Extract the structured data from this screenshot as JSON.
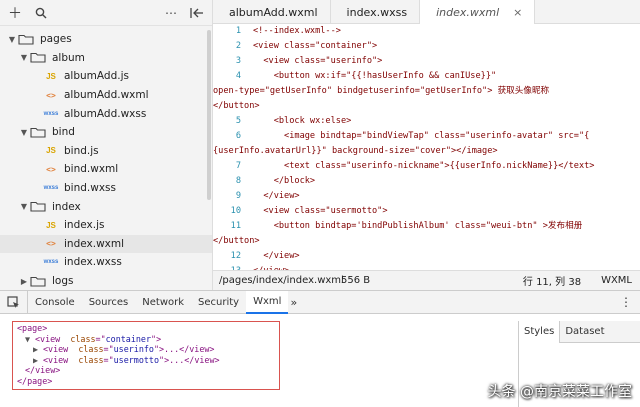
{
  "sidebar": {
    "tree": [
      {
        "label": "pages",
        "type": "folder",
        "depth": 0,
        "expanded": true
      },
      {
        "label": "album",
        "type": "folder",
        "depth": 1,
        "expanded": true
      },
      {
        "label": "albumAdd.js",
        "type": "js",
        "depth": 2
      },
      {
        "label": "albumAdd.wxml",
        "type": "wxml",
        "depth": 2
      },
      {
        "label": "albumAdd.wxss",
        "type": "wxss",
        "depth": 2
      },
      {
        "label": "bind",
        "type": "folder",
        "depth": 1,
        "expanded": true
      },
      {
        "label": "bind.js",
        "type": "js",
        "depth": 2
      },
      {
        "label": "bind.wxml",
        "type": "wxml",
        "depth": 2
      },
      {
        "label": "bind.wxss",
        "type": "wxss",
        "depth": 2
      },
      {
        "label": "index",
        "type": "folder",
        "depth": 1,
        "expanded": true
      },
      {
        "label": "index.js",
        "type": "js",
        "depth": 2
      },
      {
        "label": "index.wxml",
        "type": "wxml",
        "depth": 2,
        "selected": true
      },
      {
        "label": "index.wxss",
        "type": "wxss",
        "depth": 2
      },
      {
        "label": "logs",
        "type": "folder",
        "depth": 1,
        "expanded": false
      }
    ],
    "file_icons": {
      "js": "JS",
      "wxml": "<>",
      "wxss": "wxss"
    }
  },
  "editor": {
    "tabs": [
      {
        "label": "albumAdd.wxml",
        "active": false
      },
      {
        "label": "index.wxss",
        "active": false
      },
      {
        "label": "index.wxml",
        "active": true
      }
    ],
    "close_glyph": "×",
    "code_lines": [
      {
        "ln": "1",
        "text": "<!--index.wxml-->"
      },
      {
        "ln": "2",
        "text": "<view class=\"container\">"
      },
      {
        "ln": "3",
        "text": "  <view class=\"userinfo\">"
      },
      {
        "ln": "4",
        "text": "    <button wx:if=\"{{!hasUserInfo && canIUse}}\""
      },
      {
        "ln": "",
        "text": "open-type=\"getUserInfo\" bindgetuserinfo=\"getUserInfo\"> 获取头像昵称"
      },
      {
        "ln": "",
        "text": "</button>"
      },
      {
        "ln": "5",
        "text": "    <block wx:else>"
      },
      {
        "ln": "6",
        "text": "      <image bindtap=\"bindViewTap\" class=\"userinfo-avatar\" src=\"{"
      },
      {
        "ln": "",
        "text": "{userInfo.avatarUrl}}\" background-size=\"cover\"></image>"
      },
      {
        "ln": "7",
        "text": "      <text class=\"userinfo-nickname\">{{userInfo.nickName}}</text>"
      },
      {
        "ln": "8",
        "text": "    </block>"
      },
      {
        "ln": "9",
        "text": "  </view>"
      },
      {
        "ln": "10",
        "text": "  <view class=\"usermotto\">"
      },
      {
        "ln": "11",
        "text": "    <button bindtap='bindPublishAlbum' class=\"weui-btn\" >发布相册"
      },
      {
        "ln": "",
        "text": "</button>"
      },
      {
        "ln": "12",
        "text": "  </view>"
      },
      {
        "ln": "13",
        "text": "</view>"
      }
    ],
    "status": {
      "path": "/pages/index/index.wxml",
      "size": "556 B",
      "position": "行 11, 列 38",
      "language": "WXML"
    }
  },
  "devtools": {
    "tabs": [
      {
        "label": "Console",
        "active": false
      },
      {
        "label": "Sources",
        "active": false
      },
      {
        "label": "Network",
        "active": false
      },
      {
        "label": "Security",
        "active": false
      },
      {
        "label": "Wxml",
        "active": true
      }
    ],
    "more_label": "»",
    "menu_label": "⋮",
    "dom_tree": [
      {
        "tri": "",
        "open": "<page>"
      },
      {
        "tri": "▼",
        "tag": "view",
        "attr": "class",
        "val": "container",
        "tail": ">"
      },
      {
        "tri": "▶",
        "tag": "view",
        "attr": "class",
        "val": "userinfo",
        "tail": ">...</view>"
      },
      {
        "tri": "▶",
        "tag": "view",
        "attr": "class",
        "val": "usermotto",
        "tail": ">...</view>"
      },
      {
        "tri": "",
        "open": "</view>"
      },
      {
        "tri": "",
        "open": "</page>"
      }
    ],
    "side_tabs": [
      {
        "label": "Styles",
        "active": true
      },
      {
        "label": "Dataset",
        "active": false
      }
    ]
  },
  "watermark": "头条 @南京菜菜工作室",
  "colors": {
    "accent": "#1a73e8",
    "highlight_border": "#d9534f",
    "line_number": "#2b91af",
    "code_text": "#800000"
  }
}
